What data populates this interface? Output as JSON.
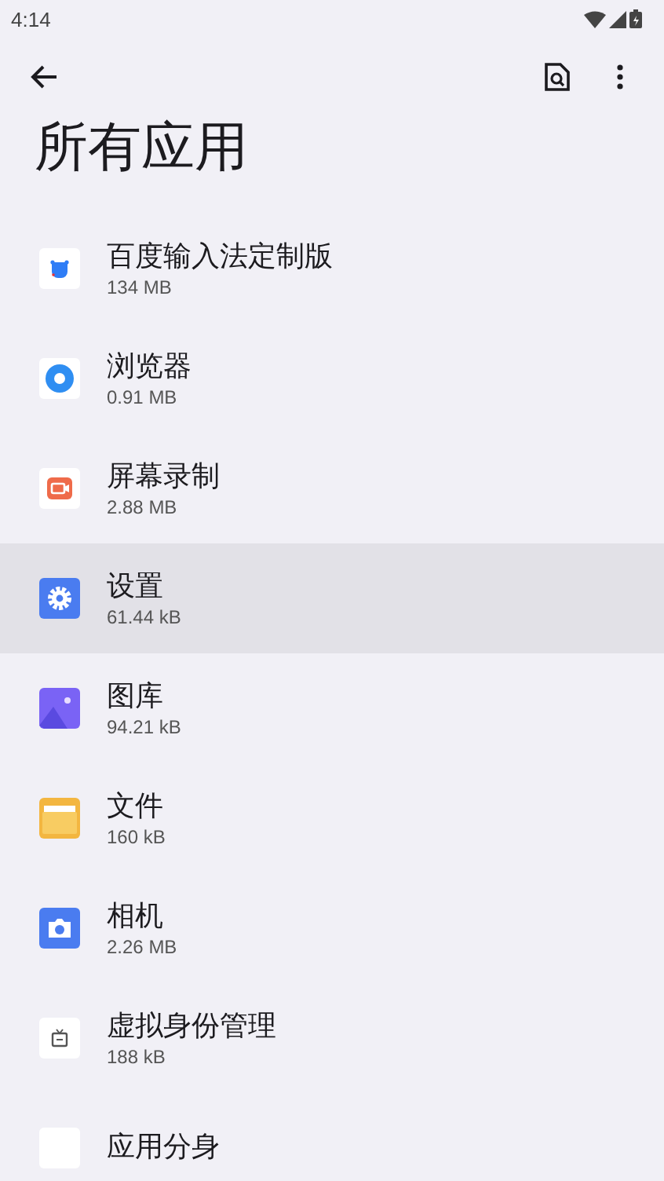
{
  "status_bar": {
    "time": "4:14"
  },
  "title": "所有应用",
  "apps": [
    {
      "name": "百度输入法定制版",
      "size": "134 MB",
      "kind": "keyboard",
      "selected": false
    },
    {
      "name": "浏览器",
      "size": "0.91 MB",
      "kind": "browser",
      "selected": false
    },
    {
      "name": "屏幕录制",
      "size": "2.88 MB",
      "kind": "recorder",
      "selected": false
    },
    {
      "name": "设置",
      "size": "61.44 kB",
      "kind": "settings",
      "selected": true
    },
    {
      "name": "图库",
      "size": "94.21 kB",
      "kind": "gallery",
      "selected": false
    },
    {
      "name": "文件",
      "size": "160 kB",
      "kind": "files",
      "selected": false
    },
    {
      "name": "相机",
      "size": "2.26 MB",
      "kind": "camera",
      "selected": false
    },
    {
      "name": "虚拟身份管理",
      "size": "188 kB",
      "kind": "tv",
      "selected": false
    },
    {
      "name": "应用分身",
      "kind": "blank",
      "selected": false
    }
  ]
}
